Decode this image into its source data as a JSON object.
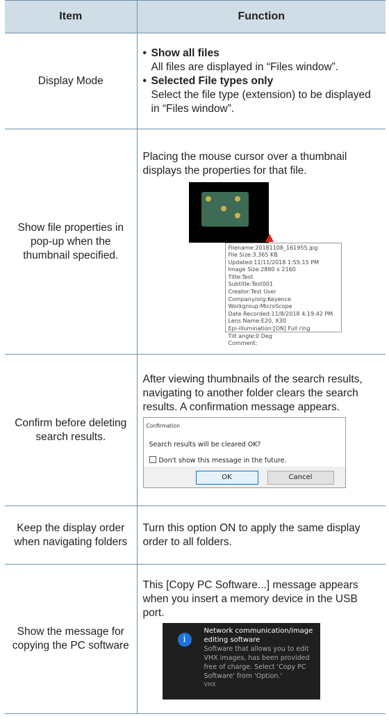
{
  "header": {
    "item": "Item",
    "function": "Function"
  },
  "rows": {
    "display_mode": {
      "item": "Display Mode",
      "bullets": [
        {
          "title": "Show all files",
          "text": "All files are displayed in “Files window”."
        },
        {
          "title": "Selected File types only",
          "text": "Select the file type (extension) to be displayed in “Files window”."
        }
      ]
    },
    "file_properties": {
      "item": "Show file properties in pop-up when the thumbnail specified.",
      "text": "Placing the mouse cursor over a thumbnail displays the properties for that file.",
      "popup": [
        "Filename:20181108_161955.jpg",
        "File Size:3.365 KB",
        "Updated:11/11/2018 1:55:15 PM",
        "Image Size:2880 x 2160",
        "Title:Test",
        "Subtitle:Test001",
        "Creator:Test User",
        "Company/org:Keyence",
        "Workgroup:MicroScope",
        "Date Recorded:11/8/2018 4:19:42 PM",
        "Lens Name:E20, X30",
        "Epi-illumination:[ON] Full ring",
        "Tilt angle:0 Deg",
        "Comment:"
      ]
    },
    "confirm_delete": {
      "item": "Confirm before deleting search results.",
      "text": "After viewing thumbnails of the search results, navigating to another folder clears the search results. A confirmation message appears.",
      "dialog": {
        "title": "Confirmation",
        "message": "Search results will be cleared OK?",
        "checkbox": "Don't show this message in the future.",
        "ok": "OK",
        "cancel": "Cancel"
      }
    },
    "display_order": {
      "item": "Keep the display order when navigating folders",
      "text": "Turn this option ON to apply the same display order to all folders."
    },
    "copy_pc": {
      "item": "Show the message for copying the PC software",
      "text": "This [Copy PC Software...] message appears when you insert a memory device in the USB port.",
      "toast": {
        "icon": "info-icon",
        "icon_glyph": "i",
        "title": "Network communication/image editing software",
        "body": "Software that allows you to edit VHX images, has been provided free of charge. Select 'Copy PC Software' from 'Option.'",
        "source": "VHX"
      }
    }
  }
}
